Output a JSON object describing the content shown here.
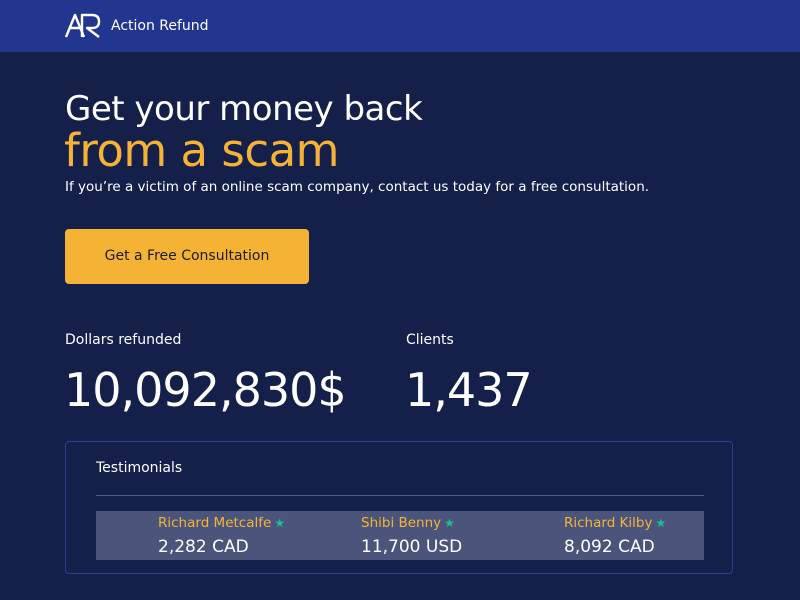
{
  "header": {
    "brand": "Action Refund",
    "logo_icon": "ar-monogram-logo"
  },
  "hero": {
    "title_line1": "Get your money back",
    "title_line2": "from a scam",
    "subtitle": "If you’re a victim of an online scam company, contact us today for a free consultation.",
    "cta_label": "Get a Free Consultation"
  },
  "stats": [
    {
      "label": "Dollars refunded",
      "value": "10,092,830$"
    },
    {
      "label": "Clients",
      "value": "1,437"
    }
  ],
  "testimonials": {
    "title": "Testimonials",
    "items": [
      {
        "name": "Richard Metcalfe",
        "amount": "2,282 CAD",
        "icon": "star-icon"
      },
      {
        "name": "Shibi Benny",
        "amount": "11,700 USD",
        "icon": "star-icon"
      },
      {
        "name": "Richard Kilby",
        "amount": "8,092 CAD",
        "icon": "star-icon"
      }
    ]
  },
  "colors": {
    "header_bg": "#22368f",
    "page_bg": "#141f4a",
    "accent": "#f5b336",
    "star": "#17c28b"
  }
}
